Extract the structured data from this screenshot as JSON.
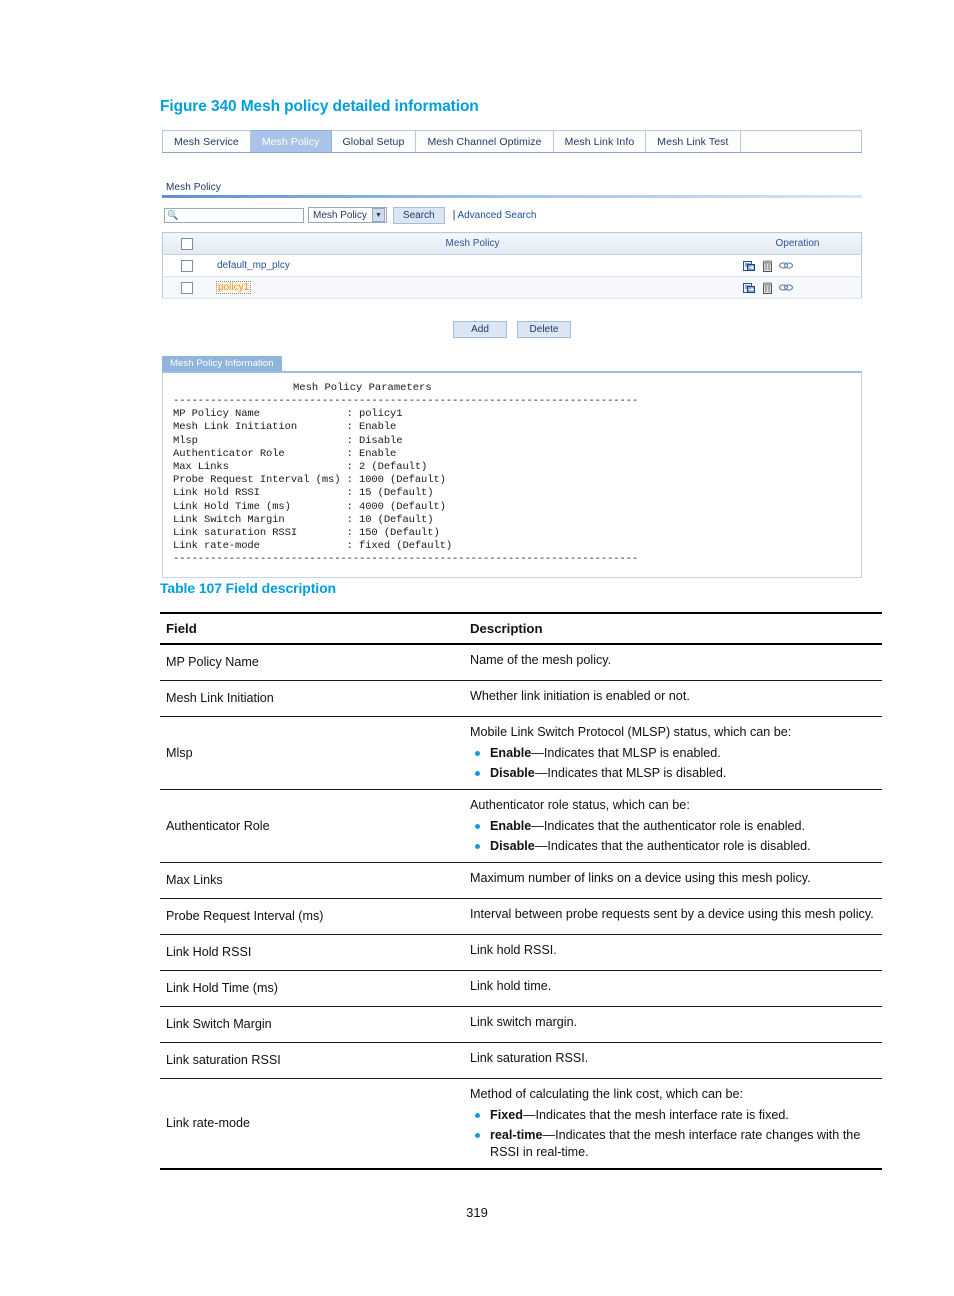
{
  "figure": {
    "caption": "Figure 340 Mesh policy detailed information",
    "tabs": [
      {
        "label": "Mesh Service",
        "active": false
      },
      {
        "label": "Mesh Policy",
        "active": true
      },
      {
        "label": "Global Setup",
        "active": false
      },
      {
        "label": "Mesh Channel Optimize",
        "active": false
      },
      {
        "label": "Mesh Link Info",
        "active": false
      },
      {
        "label": "Mesh Link Test",
        "active": false
      }
    ],
    "section_label": "Mesh Policy",
    "search": {
      "input_value": "",
      "input_placeholder": "",
      "magnifier_icon": "search-icon",
      "select_value": "Mesh Policy",
      "select_options": [
        "Mesh Policy"
      ],
      "search_button": "Search",
      "divider": "|",
      "advanced_search": "Advanced Search"
    },
    "table": {
      "headers": [
        "",
        "Mesh Policy",
        "Operation"
      ],
      "rows": [
        {
          "name": "default_mp_plcy",
          "selected": false,
          "ops": [
            "edit-icon",
            "delete-icon",
            "link-icon"
          ]
        },
        {
          "name": "policy1",
          "selected": true,
          "ops": [
            "edit-icon",
            "delete-icon",
            "link-icon"
          ]
        }
      ]
    },
    "actions": {
      "add": "Add",
      "delete": "Delete"
    },
    "info_panel": {
      "tab_label": "Mesh Policy Information",
      "title": "Mesh Policy Parameters",
      "divider": "---------------------------------------------------------------------------",
      "lines": [
        "MP Policy Name              : policy1",
        "Mesh Link Initiation        : Enable",
        "Mlsp                        : Disable",
        "Authenticator Role          : Enable",
        "Max Links                   : 2 (Default)",
        "Probe Request Interval (ms) : 1000 (Default)",
        "Link Hold RSSI              : 15 (Default)",
        "Link Hold Time (ms)         : 4000 (Default)",
        "Link Switch Margin          : 10 (Default)",
        "Link saturation RSSI        : 150 (Default)",
        "Link rate-mode              : fixed (Default)"
      ]
    }
  },
  "field_table": {
    "caption": "Table 107 Field description",
    "headers": {
      "field": "Field",
      "description": "Description"
    },
    "rows": [
      {
        "field": "MP Policy Name",
        "lead": "Name of the mesh policy.",
        "bullets": []
      },
      {
        "field": "Mesh Link Initiation",
        "lead": "Whether link initiation is enabled or not.",
        "bullets": []
      },
      {
        "field": "Mlsp",
        "lead": "Mobile Link Switch Protocol (MLSP) status, which can be:",
        "bullets": [
          {
            "term": "Enable",
            "text": "—Indicates that MLSP is enabled."
          },
          {
            "term": "Disable",
            "text": "—Indicates that MLSP is disabled."
          }
        ]
      },
      {
        "field": "Authenticator Role",
        "lead": "Authenticator role status, which can be:",
        "bullets": [
          {
            "term": "Enable",
            "text": "—Indicates that the authenticator role is enabled."
          },
          {
            "term": "Disable",
            "text": "—Indicates that the authenticator role is disabled."
          }
        ]
      },
      {
        "field": "Max Links",
        "lead": "Maximum number of links on a device using this mesh policy.",
        "bullets": []
      },
      {
        "field": "Probe Request Interval (ms)",
        "lead": "Interval between probe requests sent by a device using this mesh policy.",
        "bullets": []
      },
      {
        "field": "Link Hold RSSI",
        "lead": "Link hold RSSI.",
        "bullets": []
      },
      {
        "field": "Link Hold Time (ms)",
        "lead": "Link hold time.",
        "bullets": []
      },
      {
        "field": "Link Switch Margin",
        "lead": "Link switch margin.",
        "bullets": []
      },
      {
        "field": "Link saturation RSSI",
        "lead": "Link saturation RSSI.",
        "bullets": []
      },
      {
        "field": "Link rate-mode",
        "lead": "Method of calculating the link cost, which can be:",
        "bullets": [
          {
            "term": "Fixed",
            "text": "—Indicates that the mesh interface rate is fixed."
          },
          {
            "term": "real-time",
            "text": "—Indicates that the mesh interface rate changes with the RSSI in real-time."
          }
        ]
      }
    ]
  },
  "page_number": "319",
  "colors": {
    "heading_blue": "#009edb",
    "bullet_blue": "#179bd7",
    "tab_active_bg": "#a8c4e8",
    "link_blue": "#1a4fa0",
    "selected_orange": "#e8922a"
  }
}
